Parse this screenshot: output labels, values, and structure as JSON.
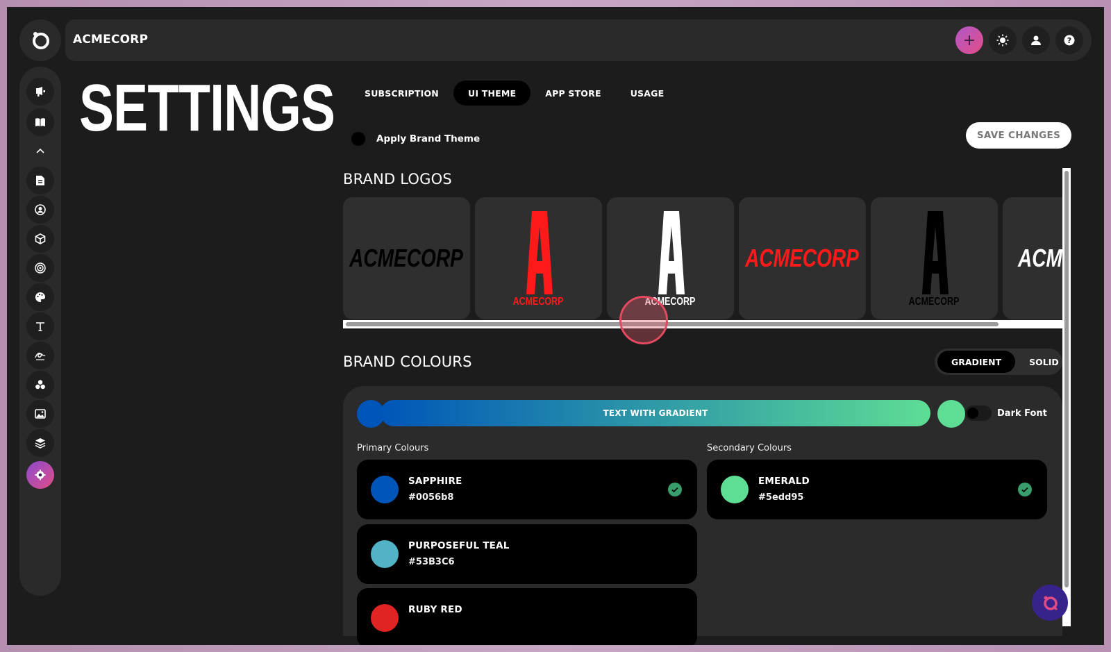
{
  "app": {
    "brand_name": "ACMECORP"
  },
  "page": {
    "title": "SETTINGS"
  },
  "topbar": {
    "icons": [
      "add-icon",
      "sun-icon",
      "user-icon",
      "help-icon"
    ]
  },
  "sidebar": {
    "items": [
      "megaphone-icon",
      "book-icon",
      "chevron-up-icon",
      "document-icon",
      "user-circle-icon",
      "cube-icon",
      "target-icon",
      "palette-icon",
      "text-icon",
      "signature-icon",
      "circles-icon",
      "image-icon",
      "layers-icon",
      "settings-icon"
    ],
    "active": "settings-icon"
  },
  "tabs": [
    {
      "label": "SUBSCRIPTION",
      "active": false
    },
    {
      "label": "UI THEME",
      "active": true
    },
    {
      "label": "APP STORE",
      "active": false
    },
    {
      "label": "USAGE",
      "active": false
    }
  ],
  "apply_brand_theme": {
    "label": "Apply Brand Theme"
  },
  "save_button": {
    "label": "SAVE CHANGES"
  },
  "brand_logos": {
    "title": "BRAND LOGOS",
    "logos": [
      {
        "text": "ACMECORP",
        "style": "wordmark",
        "color": "#000000"
      },
      {
        "text": "A",
        "sub": "ACMECORP",
        "style": "monogram",
        "color": "#ff1a1a"
      },
      {
        "text": "A",
        "sub": "ACMECORP",
        "style": "monogram",
        "color": "#ffffff"
      },
      {
        "text": "ACMECORP",
        "style": "wordmark",
        "color": "#ff1a1a"
      },
      {
        "text": "A",
        "sub": "ACMECORP",
        "style": "monogram",
        "color": "#000000"
      },
      {
        "text": "ACMECORP",
        "style": "wordmark",
        "color": "#ffffff"
      }
    ]
  },
  "brand_colours": {
    "title": "BRAND COLOURS",
    "mode_options": [
      {
        "label": "GRADIENT",
        "active": true
      },
      {
        "label": "SOLID",
        "active": false
      }
    ],
    "gradient": {
      "label": "TEXT WITH GRADIENT",
      "start": "#0056b8",
      "end": "#5edd95"
    },
    "dark_font": {
      "label": "Dark Font",
      "enabled": false
    },
    "primary": {
      "label": "Primary Colours",
      "items": [
        {
          "name": "SAPPHIRE",
          "hex": "#0056b8",
          "selected": true
        },
        {
          "name": "PURPOSEFUL TEAL",
          "hex": "#53B3C6",
          "selected": false
        },
        {
          "name": "RUBY RED",
          "hex": "",
          "color": "#e02424",
          "selected": false
        }
      ]
    },
    "secondary": {
      "label": "Secondary Colours",
      "items": [
        {
          "name": "EMERALD",
          "hex": "#5edd95",
          "selected": true
        }
      ]
    }
  },
  "colors": {
    "accent": "#e24c86",
    "background": "#1c1c1c",
    "card": "#2f2f2f"
  }
}
